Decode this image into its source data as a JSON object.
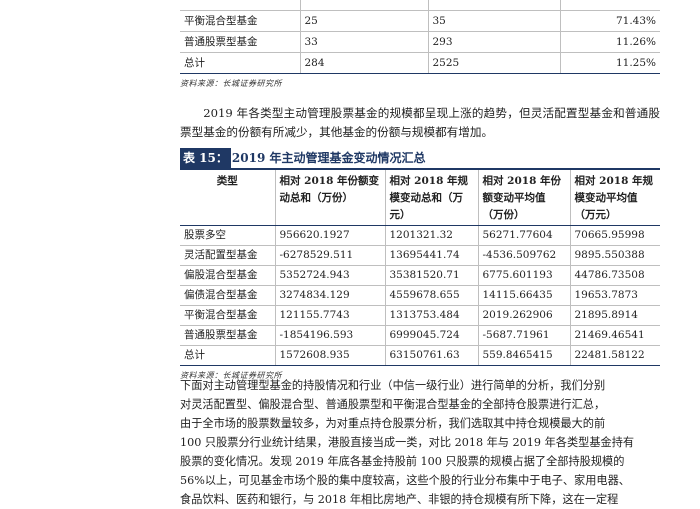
{
  "table1": {
    "rows": [
      {
        "type": "",
        "c1": "",
        "c2": "",
        "c3": ""
      },
      {
        "type": "平衡混合型基金",
        "c1": "25",
        "c2": "35",
        "c3": "71.43%"
      },
      {
        "type": "普通股票型基金",
        "c1": "33",
        "c2": "293",
        "c3": "11.26%"
      },
      {
        "type": "总计",
        "c1": "284",
        "c2": "2525",
        "c3": "11.25%"
      }
    ],
    "source": "资料来源：长城证券研究所"
  },
  "paragraph1": "2019 年各类型主动管理股票基金的规模都呈现上涨的趋势，但灵活配置型基金和普通股票型基金的份额有所减少，其他基金的份额与规模都有增加。",
  "table2": {
    "tag": "表 15：",
    "title": "2019 年主动管理基金变动情况汇总",
    "headers": [
      "类型",
      "相对 2018 年份额变动总和（万份）",
      "相对 2018 年规模变动总和（万元）",
      "相对 2018 年份额变动平均值（万份）",
      "相对 2018 年规模变动平均值（万元）"
    ],
    "rows": [
      [
        "股票多空",
        "956620.1927",
        "1201321.32",
        "56271.77604",
        "70665.95998"
      ],
      [
        "灵活配置型基金",
        "-6278529.511",
        "13695441.74",
        "-4536.509762",
        "9895.550388"
      ],
      [
        "偏股混合型基金",
        "5352724.943",
        "35381520.71",
        "6775.601193",
        "44786.73508"
      ],
      [
        "偏债混合型基金",
        "3274834.129",
        "4559678.655",
        "14115.66435",
        "19653.7873"
      ],
      [
        "平衡混合型基金",
        "121155.7743",
        "1313753.484",
        "2019.262906",
        "21895.8914"
      ],
      [
        "普通股票型基金",
        "-1854196.593",
        "6999045.724",
        "-5687.71961",
        "21469.46541"
      ],
      [
        "总计",
        "1572608.935",
        "63150761.63",
        "559.8465415",
        "22481.58122"
      ]
    ],
    "source": "资料来源：长城证券研究所"
  },
  "paragraph2": [
    "下面对主动管理型基金的持股情况和行业（中信一级行业）进行简单的分析，我们分别",
    "对灵活配置型、偏股混合型、普通股票型和平衡混合型基金的全部持仓股票进行汇总，",
    "由于全市场的股票数量较多，为对重点持仓股票分析，我们选取其中持仓规模最大的前",
    "100 只股票分行业统计结果，港股直接当成一类，对比 2018 年与 2019 年各类型基金持有",
    "股票的变化情况。发现 2019 年底各基金持股前 100 只股票的规模占据了全部持股规模的",
    "56%以上，可见基金市场个股的集中度较高，这些个股的行业分布集中于电子、家用电器、",
    "食品饮料、医药和银行，与 2018 年相比房地产、非银的持仓规模有所下降，这在一定程"
  ]
}
